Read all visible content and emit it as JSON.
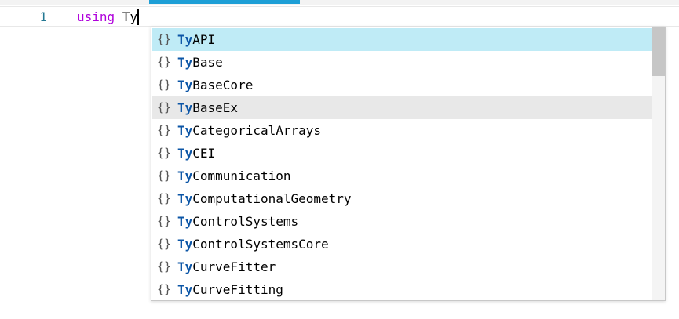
{
  "editor": {
    "line_number": "1",
    "keyword": "using",
    "typed": " Ty"
  },
  "suggestions": {
    "icon": "namespace-braces-icon",
    "icon_glyph": "{}",
    "match_prefix": "Ty",
    "focused_index": 0,
    "hovered_index": 3,
    "items": [
      {
        "rest": "API"
      },
      {
        "rest": "Base"
      },
      {
        "rest": "BaseCore"
      },
      {
        "rest": "BaseEx"
      },
      {
        "rest": "CategoricalArrays"
      },
      {
        "rest": "CEI"
      },
      {
        "rest": "Communication"
      },
      {
        "rest": "ComputationalGeometry"
      },
      {
        "rest": "ControlSystems"
      },
      {
        "rest": "ControlSystemsCore"
      },
      {
        "rest": "CurveFitter"
      },
      {
        "rest": "CurveFitting"
      }
    ]
  },
  "colors": {
    "keyword": "#af00db",
    "match": "#0b55a6",
    "focused_bg": "#bfebf6",
    "hovered_bg": "#e8e8e8",
    "tab_accent": "#1e9fd6"
  }
}
